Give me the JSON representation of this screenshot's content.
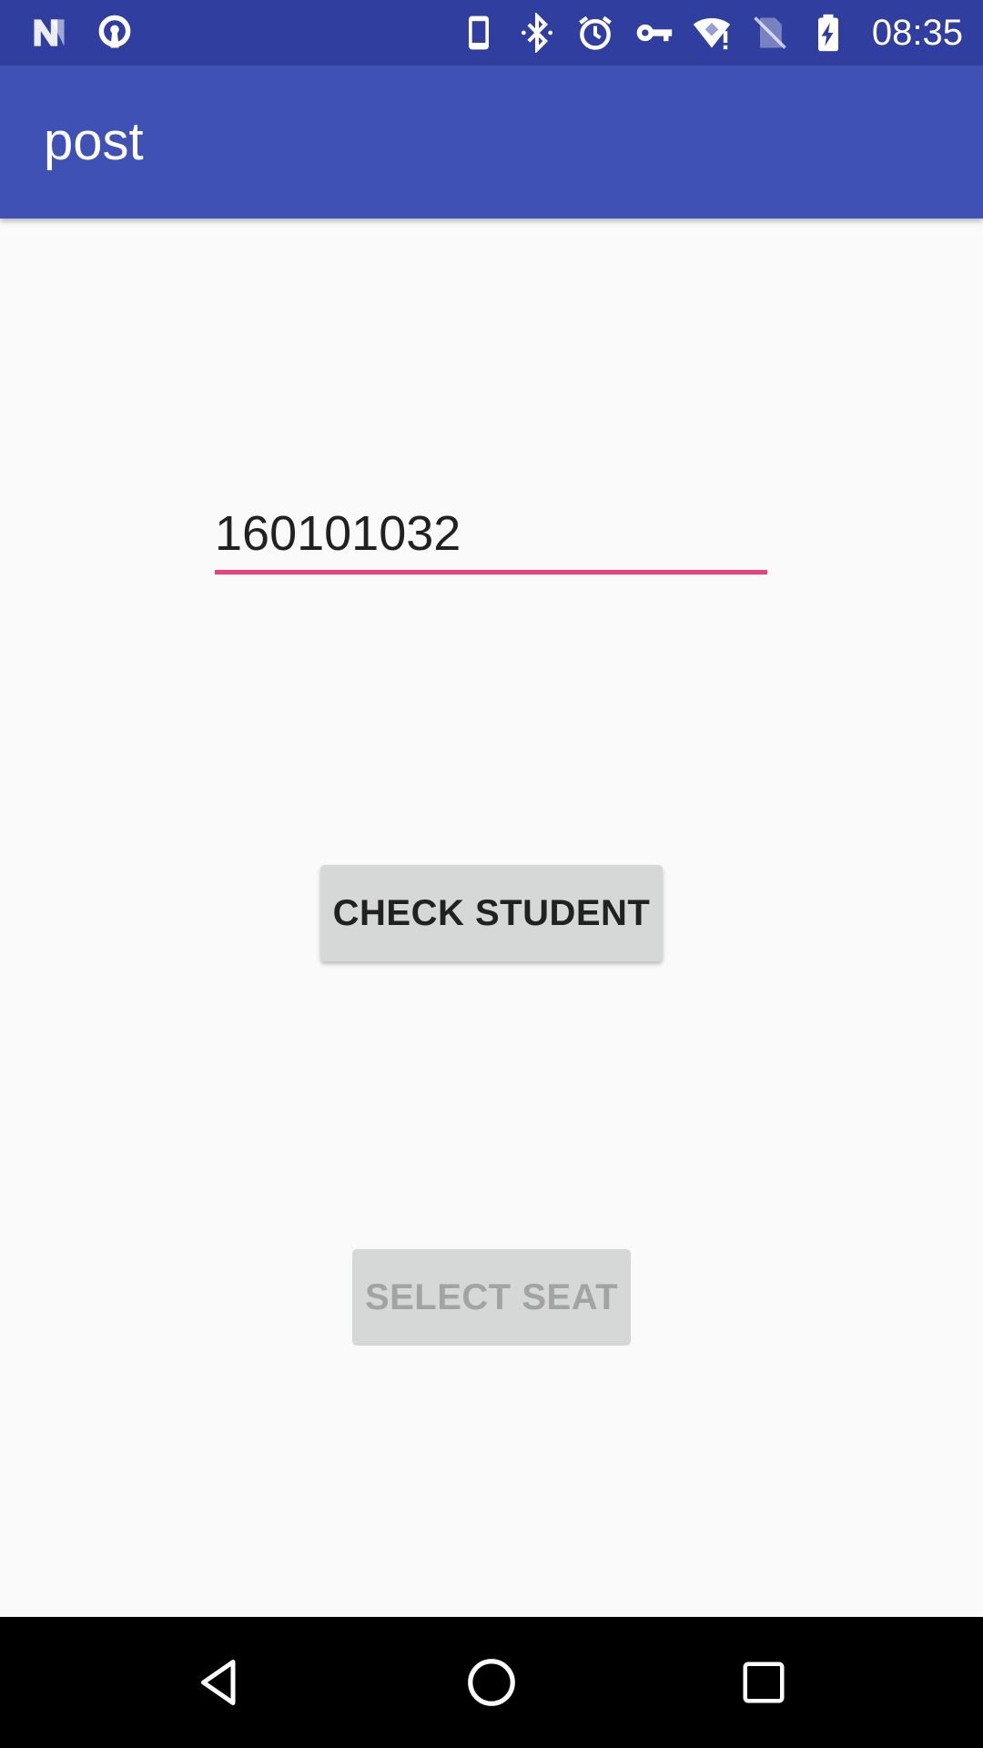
{
  "status_bar": {
    "time": "08:35",
    "icons": [
      "n-icon",
      "vpn-key-hole-icon",
      "phone-icon",
      "bluetooth-icon",
      "alarm-icon",
      "key-icon",
      "wifi-alert-icon",
      "no-sim-icon",
      "battery-charging-icon"
    ]
  },
  "app_bar": {
    "title": "post"
  },
  "form": {
    "student_id_value": "160101032",
    "check_button_label": "CHECK STUDENT",
    "select_seat_label": "SELECT SEAT"
  },
  "nav_bar": {
    "icons": [
      "back-icon",
      "home-icon",
      "recents-icon"
    ]
  },
  "colors": {
    "status_bar": "#303f9f",
    "app_bar": "#3f51b5",
    "accent": "#ec407a",
    "background": "#fafafa"
  }
}
